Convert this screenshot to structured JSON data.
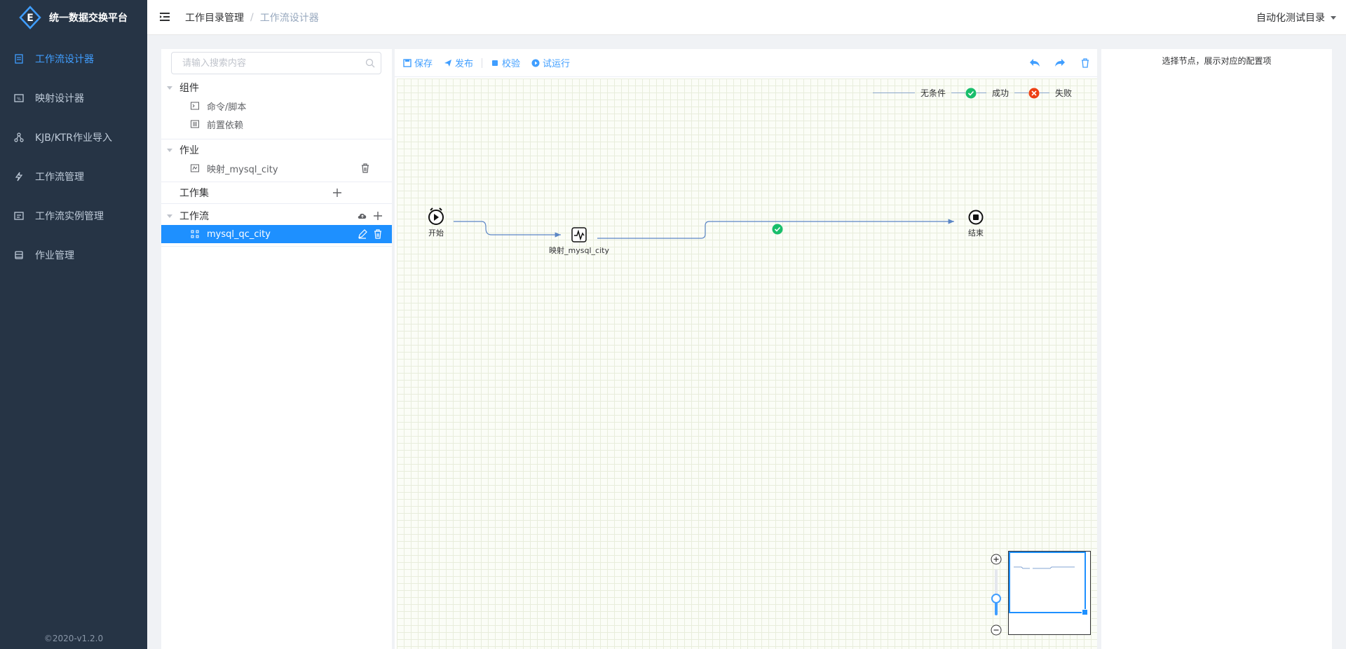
{
  "app": {
    "title": "统一数据交换平台",
    "logo_letter": "E",
    "version": "©2020-v1.2.0"
  },
  "sidebar": {
    "items": [
      {
        "label": "工作流设计器",
        "icon": "workflow-designer-icon",
        "active": true
      },
      {
        "label": "映射设计器",
        "icon": "mapping-icon",
        "active": false
      },
      {
        "label": "KJB/KTR作业导入",
        "icon": "import-icon",
        "active": false
      },
      {
        "label": "工作流管理",
        "icon": "lightning-icon",
        "active": false
      },
      {
        "label": "工作流实例管理",
        "icon": "instance-icon",
        "active": false
      },
      {
        "label": "作业管理",
        "icon": "job-icon",
        "active": false
      }
    ]
  },
  "header": {
    "breadcrumb": [
      "工作目录管理",
      "工作流设计器"
    ],
    "separator": "/",
    "directory": "自动化测试目录"
  },
  "tree": {
    "search_placeholder": "请输入搜索内容",
    "components": {
      "label": "组件",
      "children": [
        "命令/脚本",
        "前置依赖"
      ]
    },
    "jobs": {
      "label": "作业",
      "children": [
        "映射_mysql_city"
      ]
    },
    "jobset": {
      "label": "工作集"
    },
    "workflows": {
      "label": "工作流",
      "children": [
        "mysql_qc_city"
      ]
    }
  },
  "toolbar": {
    "save": "保存",
    "publish": "发布",
    "validate": "校验",
    "trial_run": "试运行"
  },
  "legend": {
    "none": "无条件",
    "success": "成功",
    "fail": "失败",
    "success_color": "#19be6b",
    "fail_color": "#ed4014"
  },
  "flow": {
    "start": "开始",
    "mapping": "映射_mysql_city",
    "end": "结束"
  },
  "config": {
    "hint": "选择节点，展示对应的配置项"
  },
  "colors": {
    "sidebar_bg": "#263445",
    "accent": "#409eff",
    "selected_row": "#1e90ff",
    "edge": "#5b86c5"
  }
}
